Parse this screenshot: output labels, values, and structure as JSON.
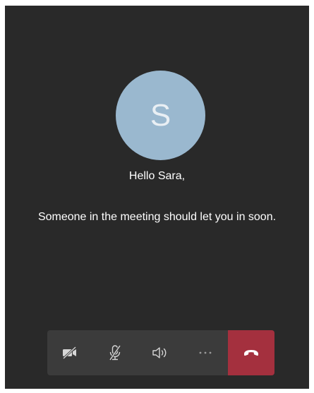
{
  "caller": {
    "initial": "S"
  },
  "lobby": {
    "greeting": "Hello Sara,",
    "message": "Someone in the meeting should let you in soon."
  },
  "toolbar": {
    "buttons": [
      {
        "name": "camera-off",
        "icon": "video-off-icon"
      },
      {
        "name": "mute",
        "icon": "mic-off-icon"
      },
      {
        "name": "speaker",
        "icon": "speaker-icon"
      },
      {
        "name": "more",
        "icon": "more-icon"
      },
      {
        "name": "hang-up",
        "icon": "hangup-icon"
      }
    ]
  },
  "colors": {
    "background": "#292929",
    "toolbar": "#3b3b3b",
    "avatar": "#9ab8cf",
    "hangup": "#a4303e",
    "text": "#ffffff"
  }
}
